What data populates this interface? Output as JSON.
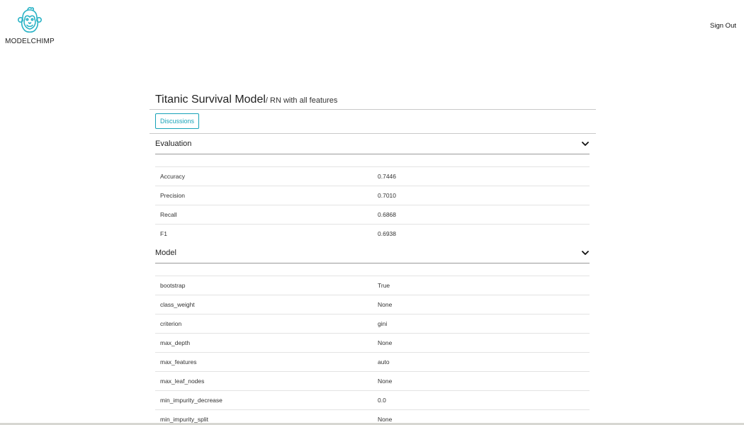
{
  "header": {
    "brand_name": "MODELCHIMP",
    "sign_out_label": "Sign Out",
    "logo_icon": "monkey-logo-icon",
    "logo_color": "#2ab3c6"
  },
  "project": {
    "title": "Titanic Survival Model",
    "separator": "/",
    "experiment": " RN with all features"
  },
  "actions": {
    "discussions_label": "Discussions",
    "accent_color": "#17a2b8"
  },
  "evaluation": {
    "title": "Evaluation",
    "toggle_icon": "chevron-down-icon",
    "rows": [
      {
        "name": "Accuracy",
        "value": "0.7446"
      },
      {
        "name": "Precision",
        "value": "0.7010"
      },
      {
        "name": "Recall",
        "value": "0.6868"
      },
      {
        "name": "F1",
        "value": "0.6938"
      }
    ]
  },
  "model": {
    "title": "Model",
    "toggle_icon": "chevron-down-icon",
    "rows": [
      {
        "name": "bootstrap",
        "value": "True"
      },
      {
        "name": "class_weight",
        "value": "None"
      },
      {
        "name": "criterion",
        "value": "gini"
      },
      {
        "name": "max_depth",
        "value": "None"
      },
      {
        "name": "max_features",
        "value": "auto"
      },
      {
        "name": "max_leaf_nodes",
        "value": "None"
      },
      {
        "name": "min_impurity_decrease",
        "value": "0.0"
      },
      {
        "name": "min_impurity_split",
        "value": "None"
      }
    ]
  }
}
